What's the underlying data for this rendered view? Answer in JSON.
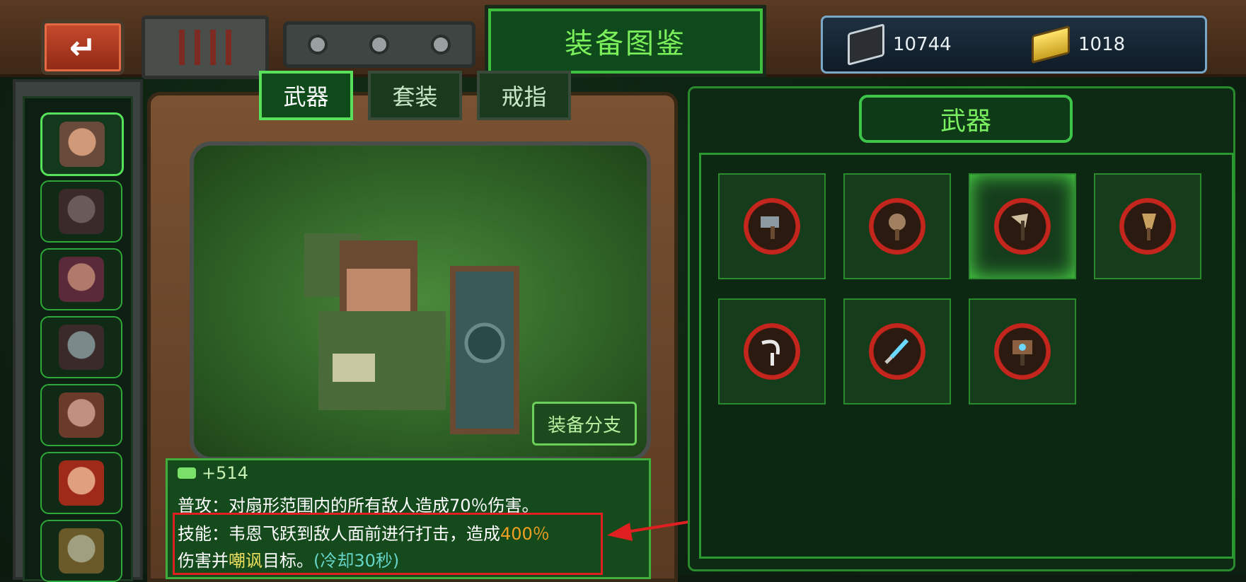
{
  "title": "装备图鉴",
  "currency": {
    "chip_value": "10744",
    "gold_value": "1018"
  },
  "tabs": [
    {
      "label": "武器",
      "active": true
    },
    {
      "label": "套装",
      "active": false
    },
    {
      "label": "戒指",
      "active": false
    }
  ],
  "branch_button": "装备分支",
  "description": {
    "stat": "+514",
    "line1": "普攻：对扇形范围内的所有敌人造成70％伤害。",
    "line2_prefix": "技能：韦恩飞跃到敌人面前进行打击，造成",
    "line2_value": "400％",
    "line3_prefix": "伤害并",
    "line3_keyword": "嘲讽",
    "line3_suffix": "目标。",
    "line3_cooldown": "(冷却30秒)"
  },
  "right_panel": {
    "title": "武器"
  },
  "heroes": [
    {
      "name": "hero-1",
      "selected": true
    },
    {
      "name": "hero-2",
      "selected": false
    },
    {
      "name": "hero-3",
      "selected": false
    },
    {
      "name": "hero-4",
      "selected": false
    },
    {
      "name": "hero-5",
      "selected": false
    },
    {
      "name": "hero-6",
      "selected": false
    },
    {
      "name": "hero-7",
      "selected": false
    }
  ],
  "weapons": [
    {
      "icon": "mech-hammer-icon",
      "highlighted": false
    },
    {
      "icon": "spiked-mace-icon",
      "highlighted": false
    },
    {
      "icon": "battle-axe-icon",
      "highlighted": true
    },
    {
      "icon": "broom-mace-icon",
      "highlighted": false
    },
    {
      "icon": "sickle-icon",
      "highlighted": false
    },
    {
      "icon": "laser-sword-icon",
      "highlighted": false
    },
    {
      "icon": "tech-hammer-icon",
      "highlighted": false
    }
  ],
  "colors": {
    "accent_green": "#55e25a",
    "highlight_orange": "#f0a020",
    "annotation_red": "#e02020"
  }
}
